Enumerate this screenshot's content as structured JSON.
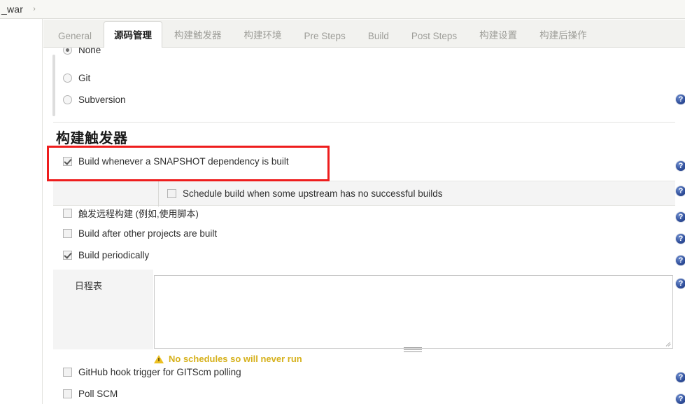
{
  "breadcrumb": {
    "item": "_war",
    "separator": "›"
  },
  "tabs": [
    {
      "label": "General",
      "active": false
    },
    {
      "label": "源码管理",
      "active": true
    },
    {
      "label": "构建触发器",
      "active": false
    },
    {
      "label": "构建环境",
      "active": false
    },
    {
      "label": "Pre Steps",
      "active": false
    },
    {
      "label": "Build",
      "active": false
    },
    {
      "label": "Post Steps",
      "active": false
    },
    {
      "label": "构建设置",
      "active": false
    },
    {
      "label": "构建后操作",
      "active": false
    }
  ],
  "scm": {
    "options": [
      {
        "label": "None",
        "checked": true
      },
      {
        "label": "Git",
        "checked": false
      },
      {
        "label": "Subversion",
        "checked": false
      }
    ]
  },
  "triggers": {
    "heading": "构建触发器",
    "snapshot": {
      "label": "Build whenever a SNAPSHOT dependency is built",
      "checked": true,
      "highlighted": true
    },
    "nested": {
      "label": "Schedule build when some upstream has no successful builds",
      "checked": false
    },
    "items": [
      {
        "label": "触发远程构建 (例如,使用脚本)",
        "checked": false
      },
      {
        "label": "Build after other projects are built",
        "checked": false
      },
      {
        "label": "Build periodically",
        "checked": true
      }
    ],
    "schedule": {
      "label": "日程表",
      "value": "",
      "warning": "No schedules so will never run"
    },
    "items_after": [
      {
        "label": "GitHub hook trigger for GITScm polling",
        "checked": false
      },
      {
        "label": "Poll SCM",
        "checked": false
      }
    ]
  },
  "icons": {
    "help": "help-icon",
    "warning": "warning-triangle-icon",
    "chevron": "chevron-right-icon"
  },
  "colors": {
    "highlight_red": "#ee1d1d",
    "warning_gold": "#d6b11c",
    "help_blue": "#33529e"
  }
}
